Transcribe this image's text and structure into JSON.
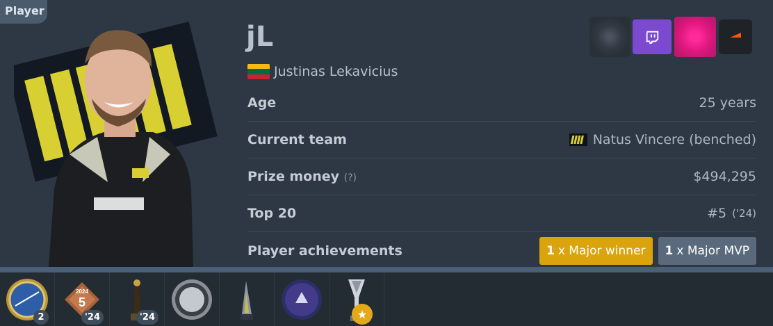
{
  "section_tag": "Player",
  "player": {
    "nickname": "jL",
    "real_name": "Justinas Lekavicius",
    "flag_colors": [
      "#fdb913",
      "#006a44",
      "#c1272d"
    ]
  },
  "socials": [
    {
      "name": "blurred-social-icon"
    },
    {
      "name": "twitch-icon",
      "color": "#7b4ad1"
    },
    {
      "name": "instagram-icon",
      "color": "#e0187f"
    },
    {
      "name": "faceit-icon",
      "color": "#1f2328"
    }
  ],
  "stats": {
    "age_label": "Age",
    "age_value": "25 years",
    "team_label": "Current team",
    "team_value": "Natus Vincere (benched)",
    "prize_label": "Prize money",
    "prize_hint": "(?)",
    "prize_value": "$494,295",
    "top20_label": "Top 20",
    "top20_value": "#5",
    "top20_year": "('24)",
    "achievements_label": "Player achievements"
  },
  "achievements": [
    {
      "count": "1",
      "text": "x Major winner",
      "color": "#dca40c"
    },
    {
      "count": "1",
      "text": "x Major MVP",
      "color": "#5a6a7c"
    }
  ],
  "trophies": [
    {
      "name": "gold-medal-icon",
      "badge": "2"
    },
    {
      "name": "top20-plaque-icon",
      "badge": "'24"
    },
    {
      "name": "statue-trophy-icon",
      "badge": "'24"
    },
    {
      "name": "silver-plate-icon",
      "badge": ""
    },
    {
      "name": "glass-trophy-icon",
      "badge": ""
    },
    {
      "name": "purple-disc-icon",
      "badge": ""
    },
    {
      "name": "major-trophy-icon",
      "badge": "★"
    }
  ]
}
